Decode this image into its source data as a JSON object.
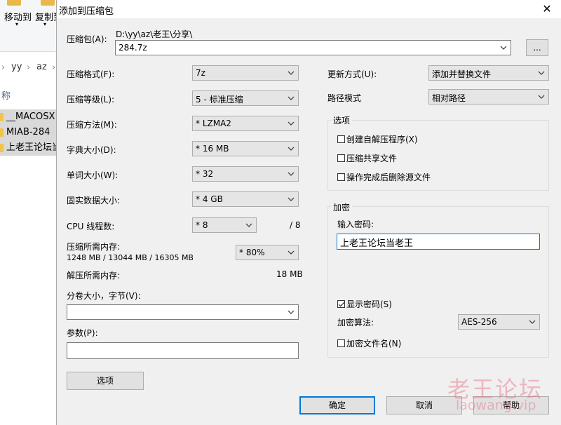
{
  "explorer": {
    "ribbon": {
      "move_to": "移动到",
      "copy_to": "复制到"
    },
    "address": {
      "part1": "yy",
      "part2": "az"
    },
    "column_header": "称",
    "files": [
      {
        "name": "__MACOSX"
      },
      {
        "name": "MIAB-284"
      },
      {
        "name": "上老王论坛当"
      }
    ]
  },
  "dialog": {
    "title": "添加到压缩包",
    "close_glyph": "✕",
    "archive": {
      "label": "压缩包(A):",
      "path": "D:\\yy\\az\\老王\\分享\\",
      "name": "284.7z",
      "browse_label": "..."
    },
    "left": {
      "format": {
        "label": "压缩格式(F):",
        "value": "7z"
      },
      "level": {
        "label": "压缩等级(L):",
        "value": "5 - 标准压缩"
      },
      "method": {
        "label": "压缩方法(M):",
        "value": "* LZMA2"
      },
      "dict": {
        "label": "字典大小(D):",
        "value": "* 16 MB"
      },
      "word": {
        "label": "单词大小(W):",
        "value": "* 32"
      },
      "solid": {
        "label": "固实数据大小:",
        "value": "* 4 GB"
      },
      "cpu": {
        "label": "CPU 线程数:",
        "value": "* 8",
        "max": "/ 8"
      },
      "mem_compress": {
        "label": "压缩所需内存:",
        "detail": "1248 MB / 13044 MB / 16305 MB",
        "value": "* 80%"
      },
      "mem_decompress": {
        "label": "解压所需内存:",
        "value": "18 MB"
      },
      "volume": {
        "label": "分卷大小，字节(V):",
        "value": ""
      },
      "params": {
        "label": "参数(P):",
        "value": ""
      },
      "options_button": "选项"
    },
    "right": {
      "update": {
        "label": "更新方式(U):",
        "value": "添加并替换文件"
      },
      "path_mode": {
        "label": "路径模式",
        "value": "相对路径"
      },
      "options_group": {
        "label": "选项",
        "sfx": {
          "label": "创建自解压程序(X)",
          "checked": false
        },
        "shared": {
          "label": "压缩共享文件",
          "checked": false
        },
        "delete": {
          "label": "操作完成后删除源文件",
          "checked": false
        }
      },
      "encryption": {
        "label": "加密",
        "password_label": "输入密码:",
        "password": "上老王论坛当老王",
        "show_password": {
          "label": "显示密码(S)",
          "checked": true
        },
        "method_label": "加密算法:",
        "method_value": "AES-256",
        "encrypt_names": {
          "label": "加密文件名(N)",
          "checked": false
        }
      }
    },
    "buttons": {
      "ok": "确定",
      "cancel": "取消",
      "help": "帮助"
    }
  },
  "watermark": {
    "cn": "老王论坛",
    "en": "laowang.vip"
  }
}
